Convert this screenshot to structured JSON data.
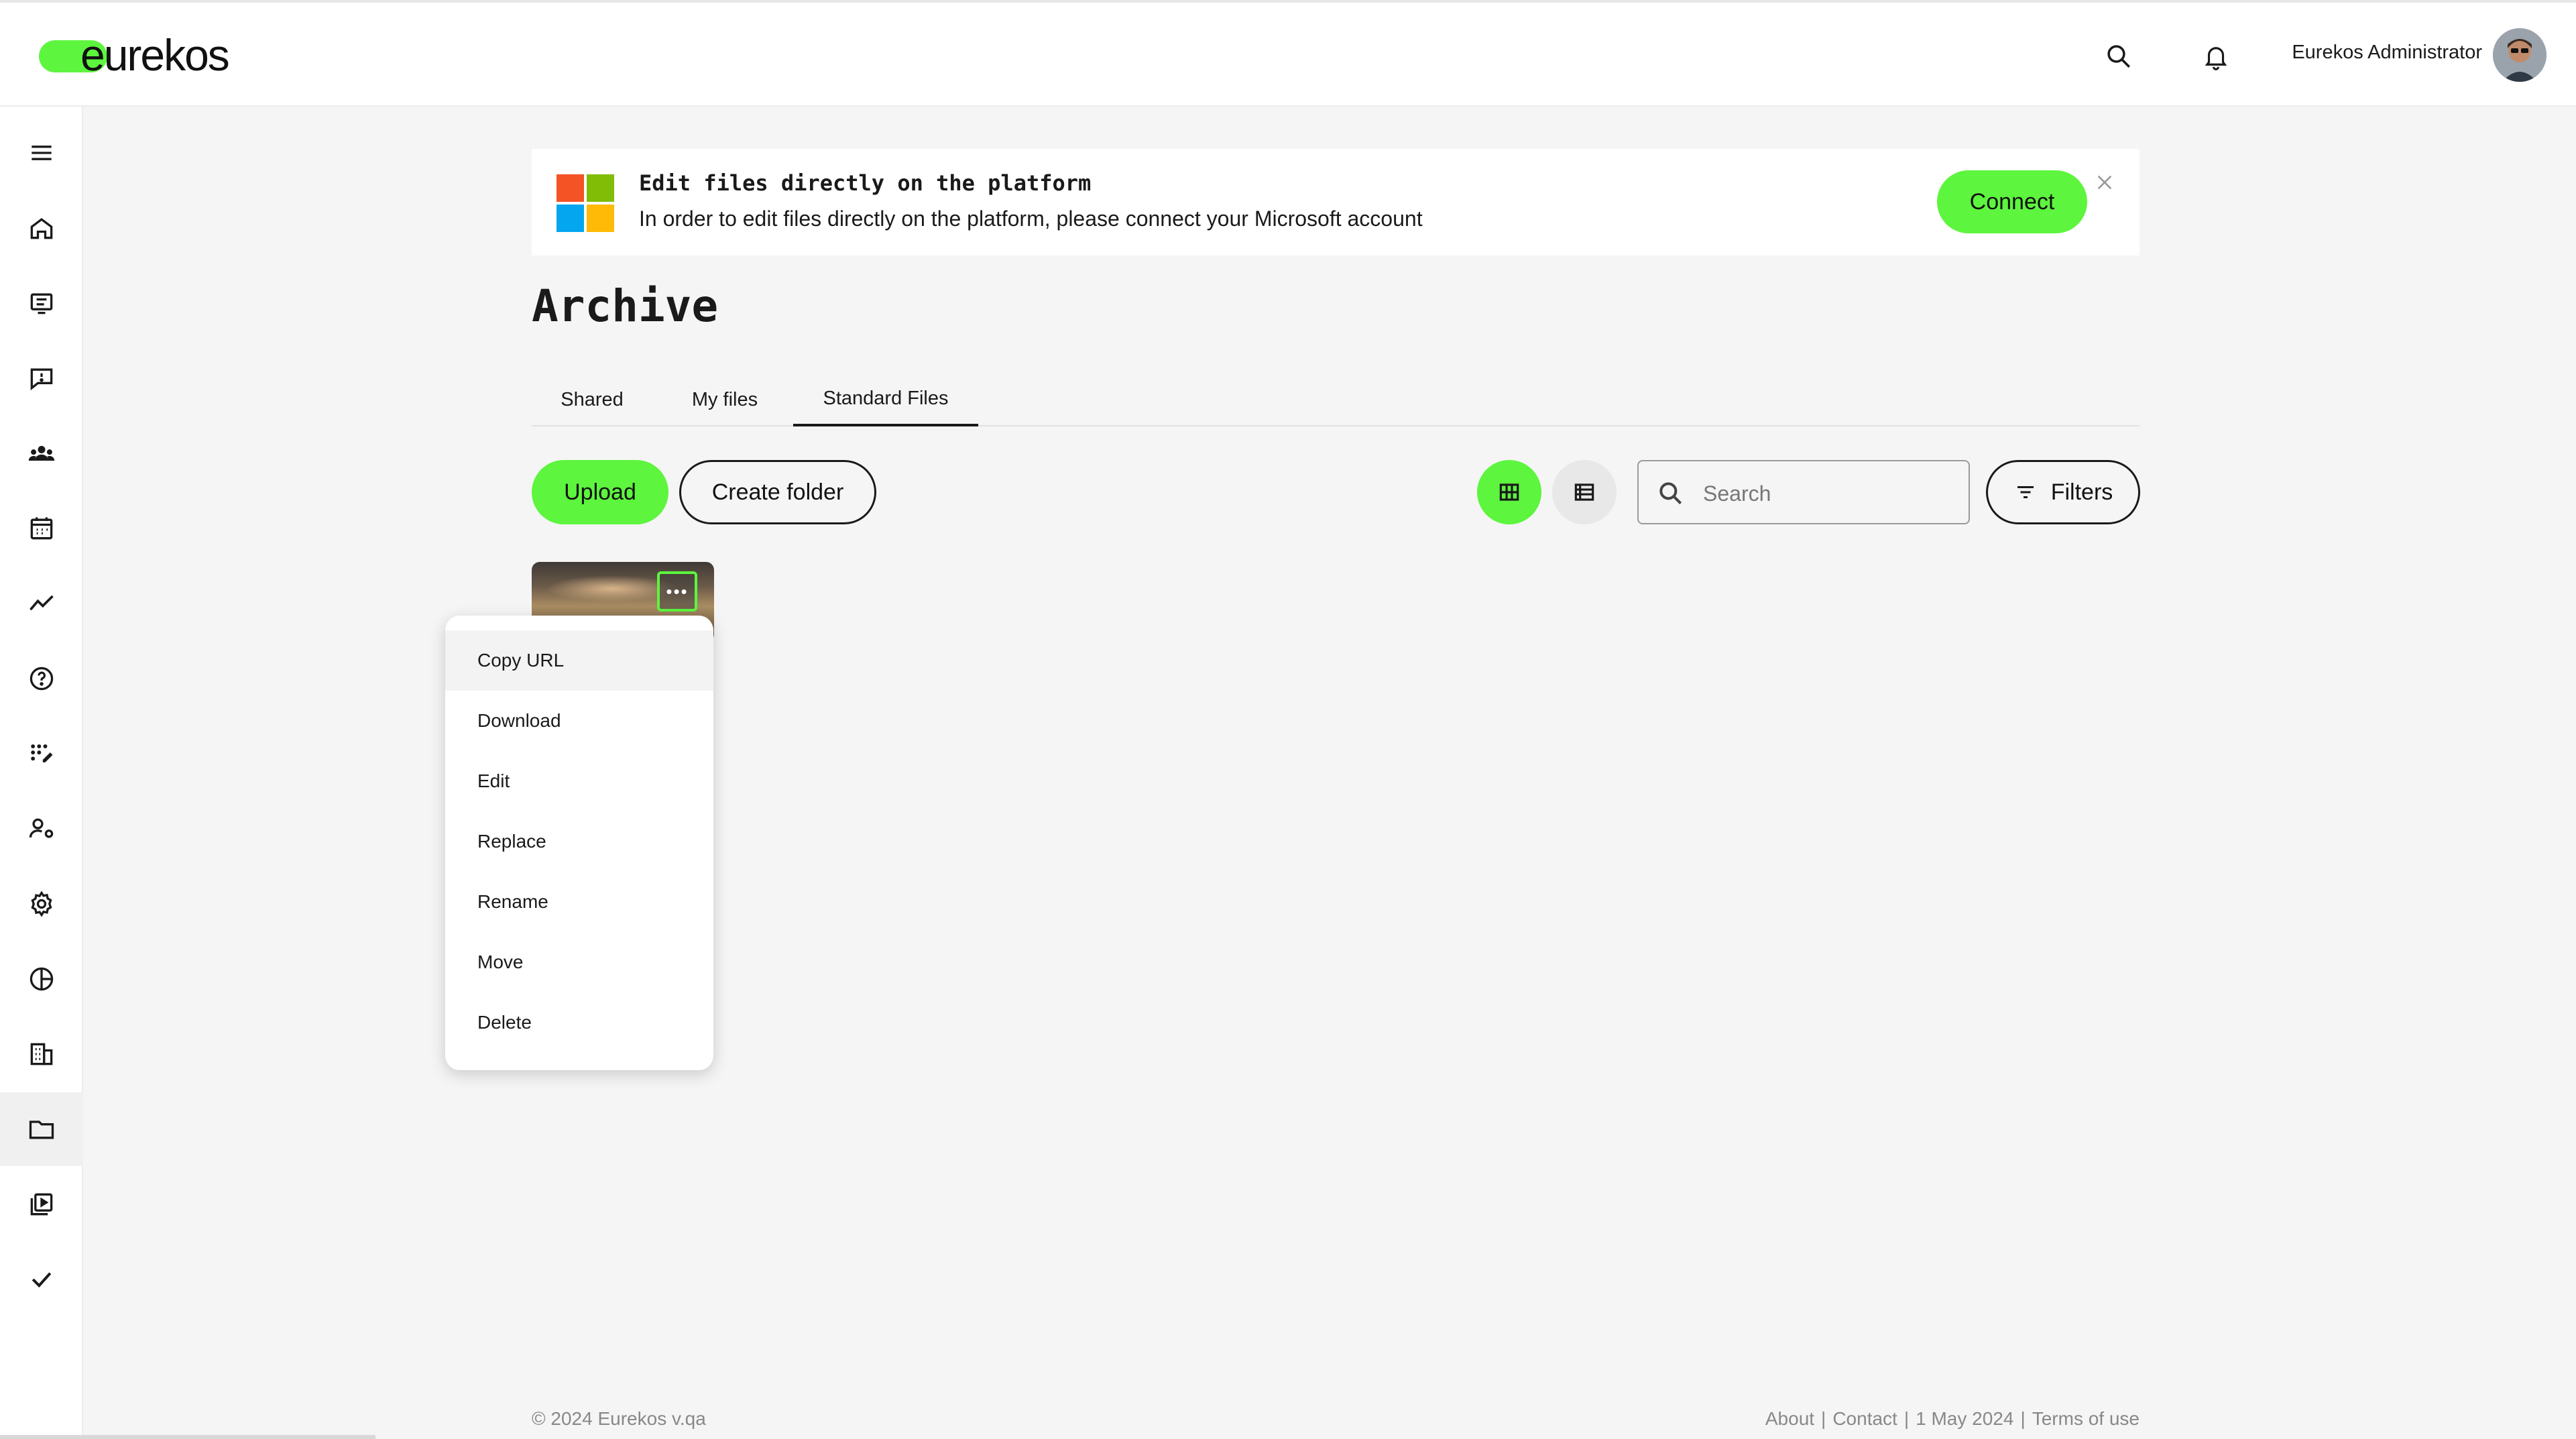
{
  "brand": {
    "logo_text": "eurekos",
    "accent": "#5df53e"
  },
  "header": {
    "user_name": "Eurekos Administrator"
  },
  "sidebar": {
    "items": [
      {
        "icon": "menu-icon"
      },
      {
        "icon": "home-icon"
      },
      {
        "icon": "courses-icon"
      },
      {
        "icon": "feedback-icon"
      },
      {
        "icon": "groups-icon"
      },
      {
        "icon": "calendar-icon"
      },
      {
        "icon": "analytics-icon"
      },
      {
        "icon": "help-icon"
      },
      {
        "icon": "skills-icon"
      },
      {
        "icon": "user-settings-icon"
      },
      {
        "icon": "settings-gear-icon"
      },
      {
        "icon": "reports-pie-icon"
      },
      {
        "icon": "organization-icon"
      },
      {
        "icon": "folder-icon",
        "active": true
      },
      {
        "icon": "media-library-icon"
      },
      {
        "icon": "checkmark-icon"
      }
    ]
  },
  "banner": {
    "title": "Edit files directly on the platform",
    "text": "In order to edit files directly on the platform, please connect your Microsoft account",
    "connect_label": "Connect"
  },
  "page": {
    "title": "Archive"
  },
  "tabs": [
    {
      "label": "Shared"
    },
    {
      "label": "My files"
    },
    {
      "label": "Standard Files",
      "active": true
    }
  ],
  "toolbar": {
    "upload_label": "Upload",
    "create_folder_label": "Create folder",
    "search_placeholder": "Search",
    "filters_label": "Filters"
  },
  "context_menu": {
    "items": [
      "Copy URL",
      "Download",
      "Edit",
      "Replace",
      "Rename",
      "Move",
      "Delete"
    ]
  },
  "footer": {
    "copyright": "© 2024 Eurekos v.qa",
    "links": [
      "About",
      "Contact",
      "1 May 2024",
      "Terms of use"
    ]
  }
}
